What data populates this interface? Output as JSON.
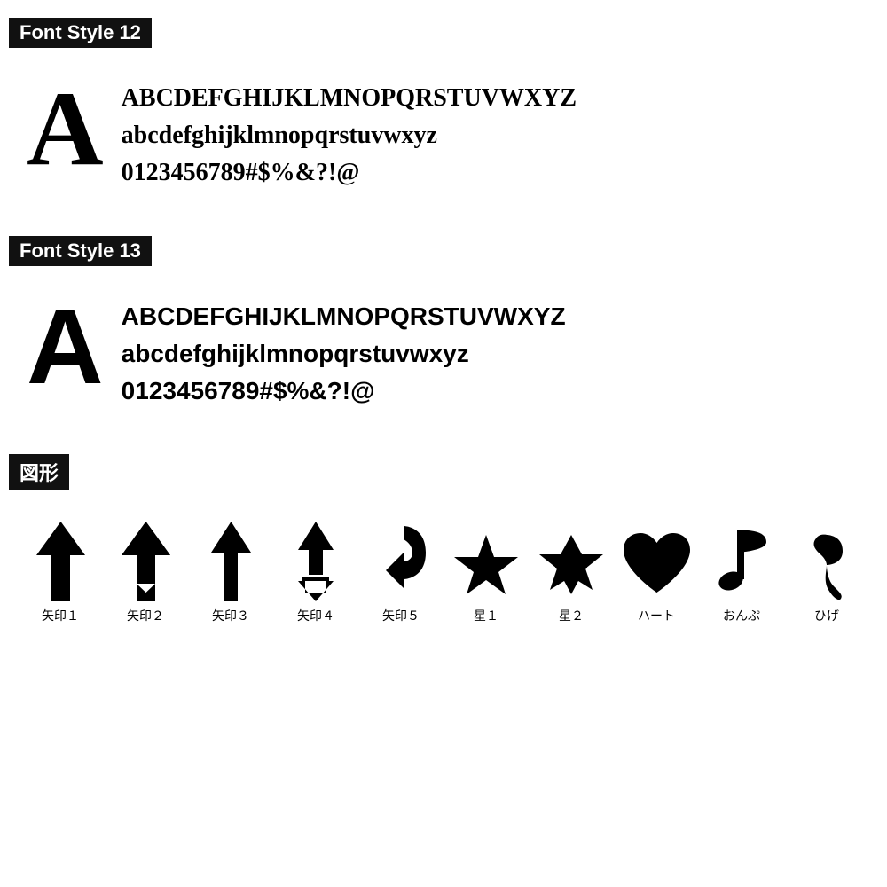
{
  "font12": {
    "label": "Font Style 12",
    "big_letter": "A",
    "line1": "ABCDEFGHIJKLMNOPQRSTUVWXYZ",
    "line2": "abcdefghijklmnopqrstuvwxyz",
    "line3": "0123456789#$%&?!@"
  },
  "font13": {
    "label": "Font Style 13",
    "big_letter": "A",
    "line1": "ABCDEFGHIJKLMNOPQRSTUVWXYZ",
    "line2": "abcdefghijklmnopqrstuvwxyz",
    "line3": "0123456789#$%&?!@"
  },
  "zukei": {
    "label": "図形",
    "shapes": [
      {
        "name": "矢印１",
        "type": "arrow1"
      },
      {
        "name": "矢印２",
        "type": "arrow2"
      },
      {
        "name": "矢印３",
        "type": "arrow3"
      },
      {
        "name": "矢印４",
        "type": "arrow4"
      },
      {
        "name": "矢印５",
        "type": "arrow5"
      },
      {
        "name": "星１",
        "type": "star1"
      },
      {
        "name": "星２",
        "type": "star2"
      },
      {
        "name": "ハート",
        "type": "heart"
      },
      {
        "name": "おんぷ",
        "type": "music"
      },
      {
        "name": "ひげ",
        "type": "mustache"
      }
    ]
  }
}
